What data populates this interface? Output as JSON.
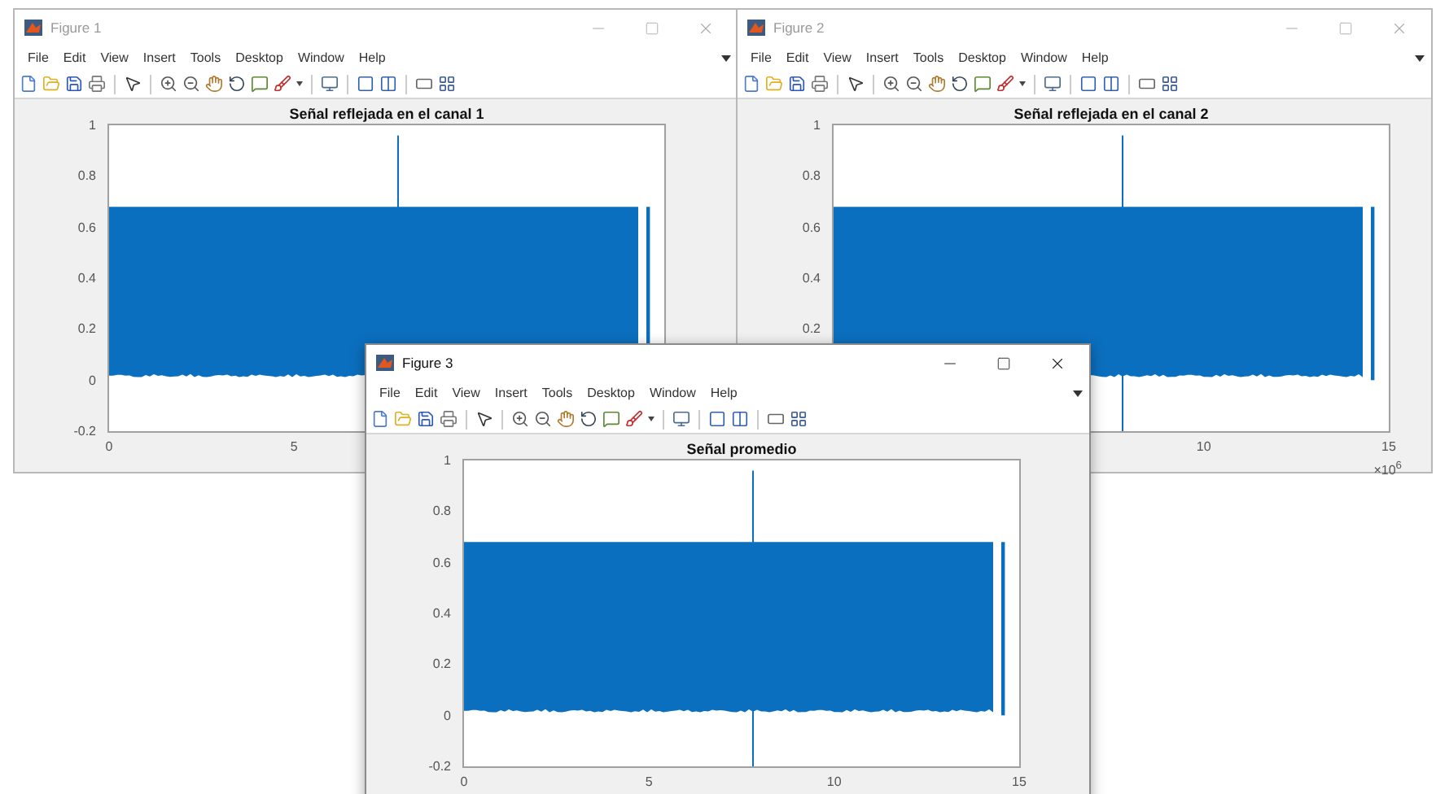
{
  "windows": [
    {
      "title": "Figure 1",
      "active": false,
      "menu": [
        "File",
        "Edit",
        "View",
        "Insert",
        "Tools",
        "Desktop",
        "Window",
        "Help"
      ],
      "plot": {
        "title": "Señal reflejada en el canal 1",
        "y_ticks": [
          "1",
          "0.8",
          "0.6",
          "0.4",
          "0.2",
          "0",
          "-0.2"
        ],
        "x_ticks": [
          "0",
          "5"
        ]
      }
    },
    {
      "title": "Figure 2",
      "active": false,
      "menu": [
        "File",
        "Edit",
        "View",
        "Insert",
        "Tools",
        "Desktop",
        "Window",
        "Help"
      ],
      "plot": {
        "title": "Señal reflejada en el canal 2",
        "y_ticks": [
          "1",
          "0.8",
          "0.6",
          "0.4",
          "0.2"
        ],
        "x_ticks": [
          "10",
          "15"
        ],
        "x_exponent": "×10$^{6}$"
      }
    },
    {
      "title": "Figure 3",
      "active": true,
      "menu": [
        "File",
        "Edit",
        "View",
        "Insert",
        "Tools",
        "Desktop",
        "Window",
        "Help"
      ],
      "plot": {
        "title": "Señal promedio",
        "y_ticks": [
          "1",
          "0.8",
          "0.6",
          "0.4",
          "0.2",
          "0",
          "-0.2"
        ],
        "x_ticks": [
          "0",
          "5",
          "10",
          "15"
        ]
      }
    }
  ]
}
